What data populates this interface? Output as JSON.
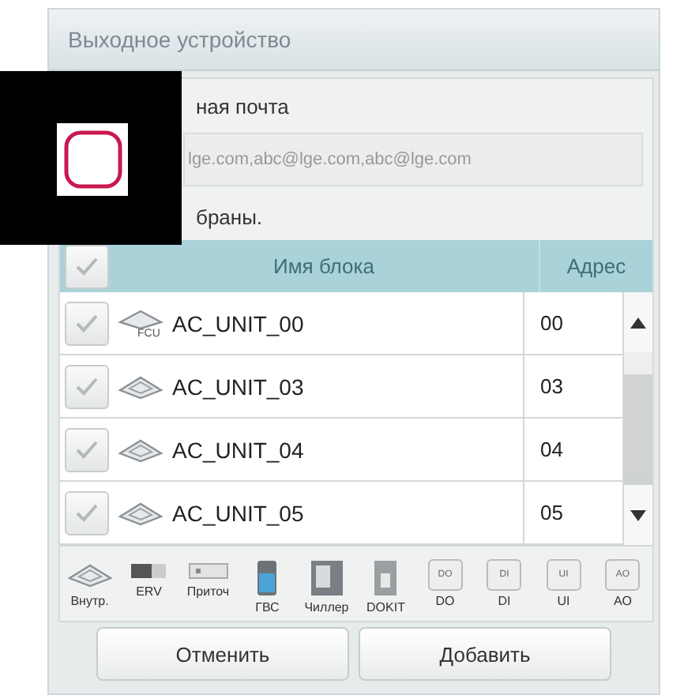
{
  "window": {
    "title": "Выходное устройство"
  },
  "email": {
    "label": "ная почта",
    "value": "lge.com,abc@lge.com,abc@lge.com"
  },
  "info_text": "браны.",
  "table": {
    "header_checked": true,
    "columns": [
      "Имя блока",
      "Адрес"
    ],
    "rows": [
      {
        "checked": true,
        "kind": "fcu",
        "badge": "FCU",
        "name": "AC_UNIT_00",
        "address": "00"
      },
      {
        "checked": true,
        "kind": "cassette",
        "name": "AC_UNIT_03",
        "address": "03"
      },
      {
        "checked": true,
        "kind": "cassette",
        "name": "AC_UNIT_04",
        "address": "04"
      },
      {
        "checked": true,
        "kind": "cassette",
        "name": "AC_UNIT_05",
        "address": "05"
      }
    ]
  },
  "device_types": [
    {
      "kind": "indoor",
      "label": "Внутр."
    },
    {
      "kind": "erv",
      "label": "ERV"
    },
    {
      "kind": "supply",
      "label": "Приточ"
    },
    {
      "kind": "boiler",
      "label": "ГВС"
    },
    {
      "kind": "chiller",
      "label": "Чиллер"
    },
    {
      "kind": "switch",
      "label": "DOKIT"
    },
    {
      "kind": "tag",
      "label": "DO",
      "tag": "DO"
    },
    {
      "kind": "tag",
      "label": "DI",
      "tag": "DI"
    },
    {
      "kind": "tag",
      "label": "UI",
      "tag": "UI"
    },
    {
      "kind": "tag",
      "label": "AO",
      "tag": "AO"
    }
  ],
  "buttons": [
    "Отменить",
    "Добавить"
  ]
}
